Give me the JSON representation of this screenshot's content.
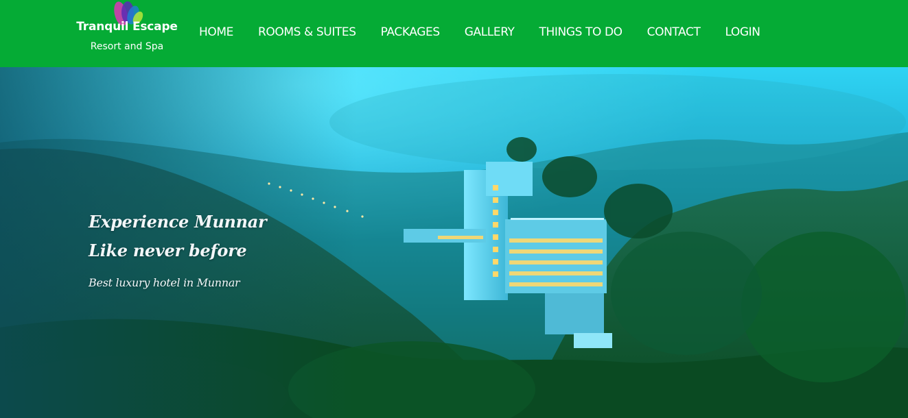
{
  "brand": {
    "name": "Tranquil Escape",
    "tagline": "Resort and Spa",
    "logo_icon": "lotus-petals-icon"
  },
  "nav": {
    "items": [
      {
        "label": "HOME"
      },
      {
        "label": "ROOMS & SUITES"
      },
      {
        "label": "PACKAGES"
      },
      {
        "label": "GALLERY"
      },
      {
        "label": "THINGS TO DO"
      },
      {
        "label": "CONTACT"
      },
      {
        "label": "LOGIN"
      }
    ]
  },
  "hero": {
    "title_line1": "Experience Munnar",
    "title_line2": "Like never before",
    "subtitle": "Best luxury hotel in Munnar"
  },
  "colors": {
    "header_bg": "#05ab35",
    "nav_text": "#ffffff",
    "hero_text": "#f2f6f8"
  }
}
